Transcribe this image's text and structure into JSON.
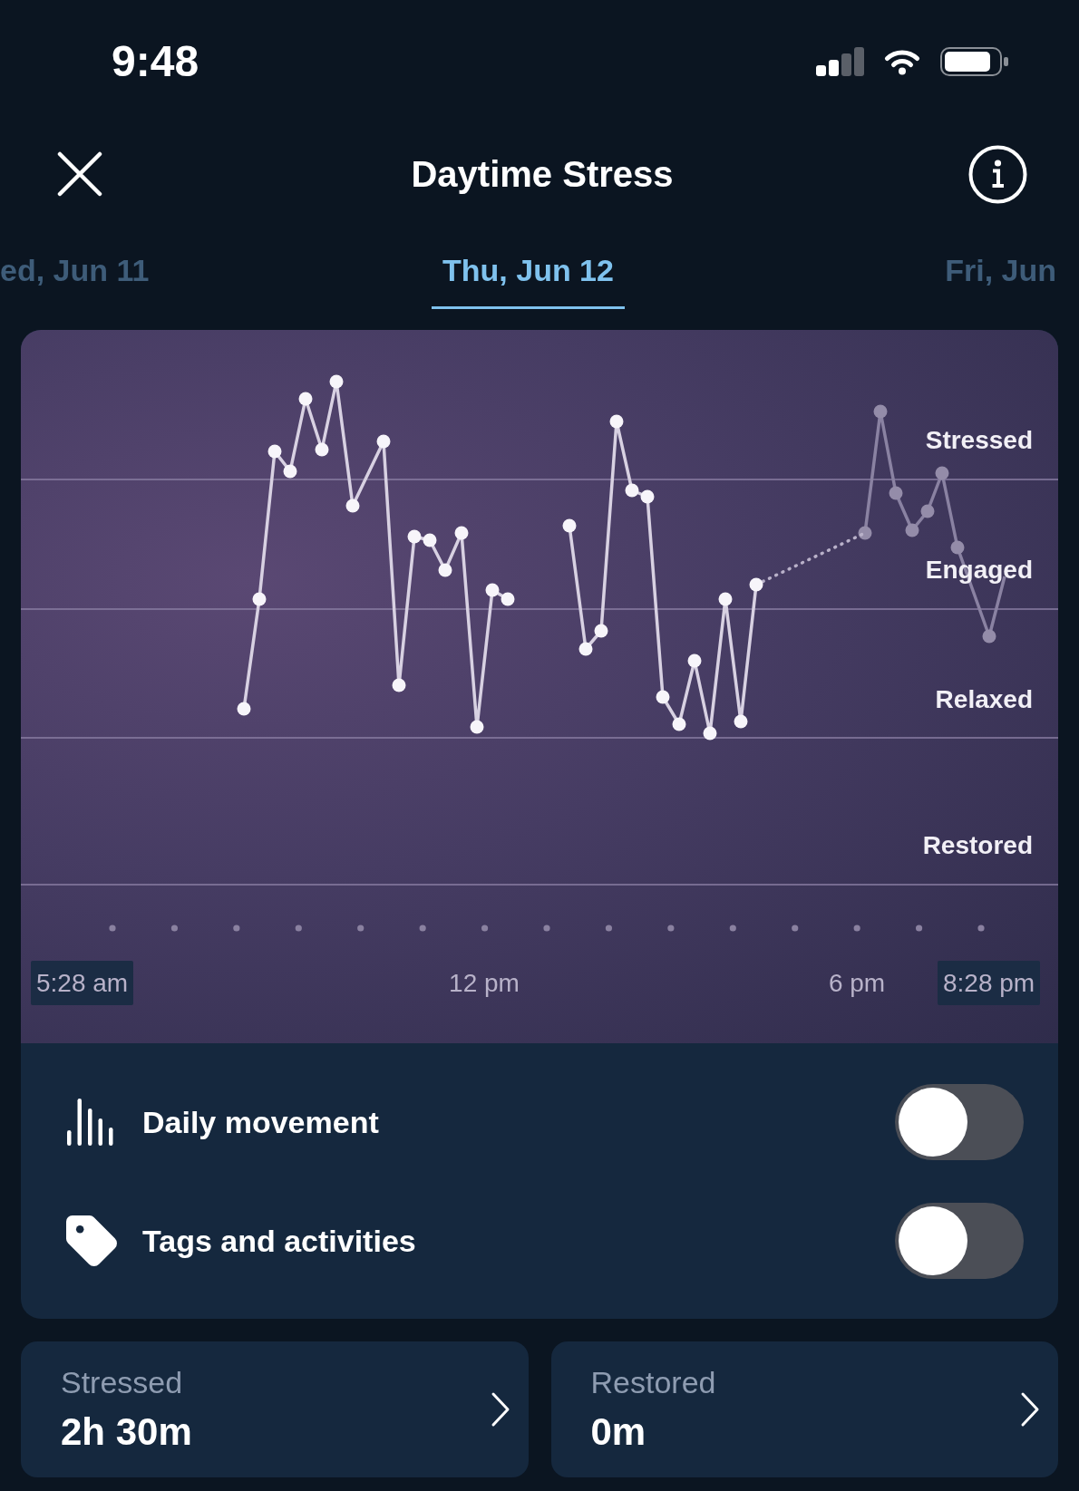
{
  "status_bar": {
    "time": "9:48"
  },
  "header": {
    "title": "Daytime Stress"
  },
  "date_tabs": [
    {
      "label": "ed, Jun 11",
      "selected": false
    },
    {
      "label": "Thu, Jun 12",
      "selected": true
    },
    {
      "label": "Fri, Jun",
      "selected": false
    }
  ],
  "chart": {
    "zone_labels": [
      "Stressed",
      "Engaged",
      "Relaxed",
      "Restored"
    ],
    "time_labels": [
      {
        "label": "5:28 am",
        "kind": "range_end"
      },
      {
        "label": "12 pm",
        "kind": "tick"
      },
      {
        "label": "6 pm",
        "kind": "tick"
      },
      {
        "label": "8:28 pm",
        "kind": "range_end"
      }
    ]
  },
  "toggles": [
    {
      "kind": "movement",
      "label": "Daily movement",
      "on": false
    },
    {
      "kind": "tag",
      "label": "Tags and activities",
      "on": false
    }
  ],
  "summary": [
    {
      "label": "Stressed",
      "value": "2h 30m"
    },
    {
      "label": "Restored",
      "value": "0m"
    }
  ]
}
